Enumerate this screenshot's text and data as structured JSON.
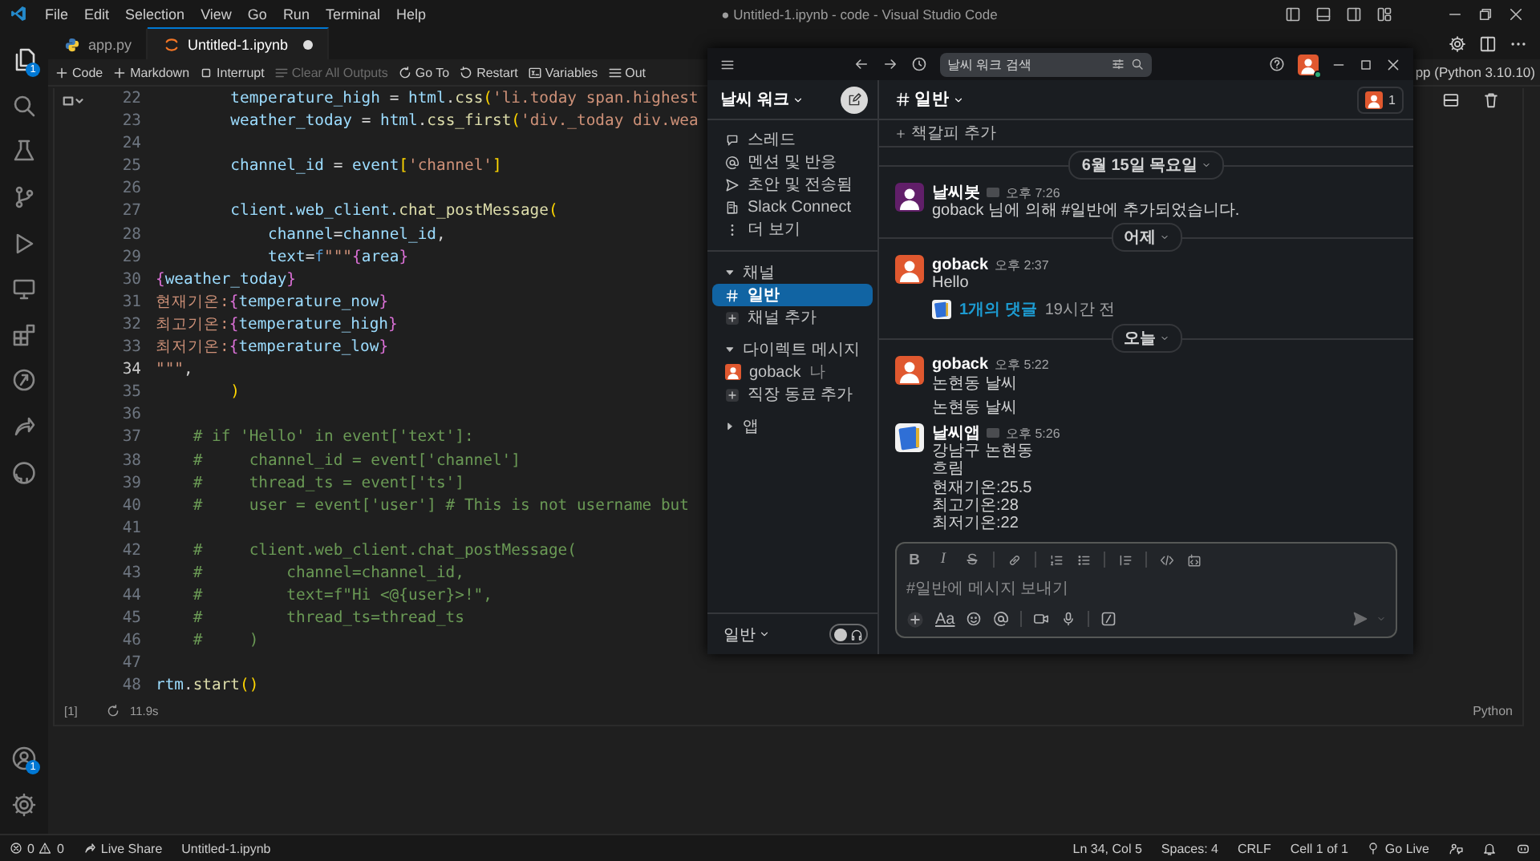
{
  "title_bar": {
    "menus": [
      "File",
      "Edit",
      "Selection",
      "View",
      "Go",
      "Run",
      "Terminal",
      "Help"
    ],
    "title": "● Untitled-1.ipynb - code - Visual Studio Code"
  },
  "activity_bar": {
    "top": [
      {
        "kind": "files",
        "badge": "1"
      },
      {
        "kind": "search"
      },
      {
        "kind": "flask"
      },
      {
        "kind": "branch"
      },
      {
        "kind": "run"
      },
      {
        "kind": "monitor"
      },
      {
        "kind": "blocks"
      },
      {
        "kind": "circle"
      },
      {
        "kind": "share"
      },
      {
        "kind": "octo"
      }
    ],
    "bottom": [
      {
        "kind": "account",
        "badge": "1"
      },
      {
        "kind": "gear"
      }
    ]
  },
  "tabs": [
    {
      "label": "app.py",
      "kind": "python",
      "selected": false,
      "dirty": false
    },
    {
      "label": "Untitled-1.ipynb",
      "kind": "notebook",
      "selected": true,
      "dirty": true
    }
  ],
  "notebook_toolbar": [
    {
      "label": "Code",
      "kind": "plus",
      "disabled": false
    },
    {
      "label": "Markdown",
      "kind": "plus",
      "disabled": false
    },
    {
      "label": "Interrupt",
      "kind": "stop",
      "disabled": false
    },
    {
      "label": "Clear All Outputs",
      "kind": "clear",
      "disabled": true
    },
    {
      "label": "Go To",
      "kind": "goto",
      "disabled": false
    },
    {
      "label": "Restart",
      "kind": "restart",
      "disabled": false
    },
    {
      "label": "Variables",
      "kind": "variables",
      "disabled": false
    },
    {
      "label": "Out",
      "kind": "outline",
      "disabled": false
    }
  ],
  "kernel": "pp (Python 3.10.10)",
  "cell": {
    "execution_count": "[1]",
    "duration": "11.9s",
    "language": "Python",
    "lines": [
      {
        "number": "22",
        "current": false,
        "tokens": [
          {
            "kind": "var",
            "text": "        temperature_high"
          },
          {
            "kind": "op",
            "text": " = "
          },
          {
            "kind": "var",
            "text": "html"
          },
          {
            "kind": "op",
            "text": "."
          },
          {
            "kind": "fn",
            "text": "css"
          },
          {
            "kind": "brace",
            "text": "("
          },
          {
            "kind": "str",
            "text": "'li.today span.highest"
          }
        ]
      },
      {
        "number": "23",
        "current": false,
        "tokens": [
          {
            "kind": "var",
            "text": "        weather_today"
          },
          {
            "kind": "op",
            "text": " = "
          },
          {
            "kind": "var",
            "text": "html"
          },
          {
            "kind": "op",
            "text": "."
          },
          {
            "kind": "fn",
            "text": "css_first"
          },
          {
            "kind": "brace",
            "text": "("
          },
          {
            "kind": "str",
            "text": "'div._today div.wea"
          }
        ]
      },
      {
        "number": "24",
        "current": false
      },
      {
        "number": "25",
        "current": false,
        "tokens": [
          {
            "kind": "var",
            "text": "        channel_id"
          },
          {
            "kind": "op",
            "text": " = "
          },
          {
            "kind": "var",
            "text": "event"
          },
          {
            "kind": "brace",
            "text": "["
          },
          {
            "kind": "str",
            "text": "'channel'"
          },
          {
            "kind": "brace",
            "text": "]"
          }
        ]
      },
      {
        "number": "26",
        "current": false
      },
      {
        "number": "27",
        "current": false,
        "tokens": [
          {
            "kind": "var",
            "text": "        client.web_client."
          },
          {
            "kind": "fn",
            "text": "chat_postMessage"
          },
          {
            "kind": "brace",
            "text": "("
          }
        ]
      },
      {
        "number": "28",
        "current": false,
        "tokens": [
          {
            "kind": "var",
            "text": "            channel"
          },
          {
            "kind": "op",
            "text": "="
          },
          {
            "kind": "var",
            "text": "channel_id"
          },
          {
            "kind": "op",
            "text": ","
          }
        ]
      },
      {
        "number": "29",
        "current": false,
        "tokens": [
          {
            "kind": "var",
            "text": "            text"
          },
          {
            "kind": "op",
            "text": "="
          },
          {
            "kind": "keyword",
            "text": "f"
          },
          {
            "kind": "str",
            "text": "\"\"\""
          },
          {
            "kind": "interp",
            "text": "{"
          },
          {
            "kind": "var",
            "text": "area"
          },
          {
            "kind": "interp",
            "text": "}"
          }
        ]
      },
      {
        "number": "30",
        "current": false,
        "tokens": [
          {
            "kind": "interp",
            "text": "{"
          },
          {
            "kind": "var",
            "text": "weather_today"
          },
          {
            "kind": "interp",
            "text": "}"
          }
        ]
      },
      {
        "number": "31",
        "current": false,
        "tokens": [
          {
            "kind": "str",
            "text": "현재기온:"
          },
          {
            "kind": "interp",
            "text": "{"
          },
          {
            "kind": "var",
            "text": "temperature_now"
          },
          {
            "kind": "interp",
            "text": "}"
          }
        ]
      },
      {
        "number": "32",
        "current": false,
        "tokens": [
          {
            "kind": "str",
            "text": "최고기온:"
          },
          {
            "kind": "interp",
            "text": "{"
          },
          {
            "kind": "var",
            "text": "temperature_high"
          },
          {
            "kind": "interp",
            "text": "}"
          }
        ]
      },
      {
        "number": "33",
        "current": false,
        "tokens": [
          {
            "kind": "str",
            "text": "최저기온:"
          },
          {
            "kind": "interp",
            "text": "{"
          },
          {
            "kind": "var",
            "text": "temperature_low"
          },
          {
            "kind": "interp",
            "text": "}"
          }
        ]
      },
      {
        "number": "34",
        "current": true,
        "tokens": [
          {
            "kind": "str",
            "text": "\"\"\""
          },
          {
            "kind": "op",
            "text": ","
          }
        ]
      },
      {
        "number": "35",
        "current": false,
        "tokens": [
          {
            "kind": "brace",
            "text": "        )"
          }
        ]
      },
      {
        "number": "36",
        "current": false
      },
      {
        "number": "37",
        "current": false,
        "tokens": [
          {
            "kind": "comment",
            "text": "    # if 'Hello' in event['text']:"
          }
        ]
      },
      {
        "number": "38",
        "current": false,
        "tokens": [
          {
            "kind": "comment",
            "text": "    #     channel_id = event['channel']"
          }
        ]
      },
      {
        "number": "39",
        "current": false,
        "tokens": [
          {
            "kind": "comment",
            "text": "    #     thread_ts = event['ts']"
          }
        ]
      },
      {
        "number": "40",
        "current": false,
        "tokens": [
          {
            "kind": "comment",
            "text": "    #     user = event['user'] # This is not username but"
          }
        ]
      },
      {
        "number": "41",
        "current": false
      },
      {
        "number": "42",
        "current": false,
        "tokens": [
          {
            "kind": "comment",
            "text": "    #     client.web_client.chat_postMessage("
          }
        ]
      },
      {
        "number": "43",
        "current": false,
        "tokens": [
          {
            "kind": "comment",
            "text": "    #         channel=channel_id,"
          }
        ]
      },
      {
        "number": "44",
        "current": false,
        "tokens": [
          {
            "kind": "comment",
            "text": "    #         text=f\"Hi <@{user}>!\","
          }
        ]
      },
      {
        "number": "45",
        "current": false,
        "tokens": [
          {
            "kind": "comment",
            "text": "    #         thread_ts=thread_ts"
          }
        ]
      },
      {
        "number": "46",
        "current": false,
        "tokens": [
          {
            "kind": "comment",
            "text": "    #     )"
          }
        ]
      },
      {
        "number": "47",
        "current": false
      },
      {
        "number": "48",
        "current": false,
        "tokens": [
          {
            "kind": "var",
            "text": "rtm"
          },
          {
            "kind": "op",
            "text": "."
          },
          {
            "kind": "fn",
            "text": "start"
          },
          {
            "kind": "brace",
            "text": "()"
          }
        ]
      }
    ]
  },
  "slack": {
    "search": {
      "placeholder": "날씨 워크 검색"
    },
    "workspace": "날씨 워크",
    "nav": [
      {
        "label": "스레드",
        "kind": "threads"
      },
      {
        "label": "멘션 및 반응",
        "kind": "mentions"
      },
      {
        "label": "초안 및 전송됨",
        "kind": "drafts"
      },
      {
        "label": "Slack Connect",
        "kind": "connect"
      },
      {
        "label": "더 보기",
        "kind": "more"
      }
    ],
    "sections": [
      {
        "title": "채널",
        "expanded": true,
        "items": [
          {
            "label": "일반",
            "kind": "channel",
            "selected": true
          },
          {
            "label": "채널 추가",
            "kind": "add",
            "selected": false
          }
        ]
      },
      {
        "title": "다이렉트 메시지",
        "expanded": true,
        "items": [
          {
            "label": "goback",
            "suffix": "나",
            "kind": "user",
            "selected": false
          },
          {
            "label": "직장 동료 추가",
            "kind": "add",
            "selected": false
          }
        ]
      },
      {
        "title": "앱",
        "expanded": false
      }
    ],
    "footer": {
      "label": "일반",
      "huddle_on": false
    },
    "channel": {
      "name": "일반",
      "members": "1",
      "bookmark": "책갈피 추가"
    },
    "feed": [
      {
        "kind": "divider",
        "label": "6월 15일 목요일"
      },
      {
        "kind": "message",
        "avatar": {
          "kind": "bot"
        },
        "author": "날씨봇",
        "app": true,
        "time": "오후 7:26",
        "lines": [
          "goback 님에 의해 #일반에 추가되었습니다."
        ]
      },
      {
        "kind": "divider",
        "label": "어제"
      },
      {
        "kind": "message",
        "avatar": {
          "kind": "user"
        },
        "author": "goback",
        "app": false,
        "time": "오후 2:37",
        "lines": [
          "Hello"
        ],
        "thread": {
          "replies": "1개의 댓글",
          "ago": "19시간 전"
        }
      },
      {
        "kind": "divider",
        "label": "오늘"
      },
      {
        "kind": "message",
        "avatar": {
          "kind": "user"
        },
        "author": "goback",
        "app": false,
        "time": "오후 5:22",
        "lines": [
          "논현동 날씨"
        ]
      },
      {
        "kind": "continuation",
        "lines": [
          "논현동 날씨"
        ]
      },
      {
        "kind": "message",
        "avatar": {
          "kind": "app"
        },
        "author": "날씨앱",
        "app": true,
        "time": "오후 5:26",
        "lines": [
          "강남구 논현동",
          "흐림",
          "현재기온:25.5",
          "최고기온:28",
          "최저기온:22"
        ]
      }
    ],
    "composer": {
      "placeholder": "#일반에 메시지 보내기",
      "format": [
        {
          "kind": "bold",
          "label": "B"
        },
        {
          "kind": "italic",
          "label": "I"
        },
        {
          "kind": "strike",
          "label": "S"
        },
        {
          "kind": "separator"
        },
        {
          "kind": "link"
        },
        {
          "kind": "separator"
        },
        {
          "kind": "ordered"
        },
        {
          "kind": "bullets"
        },
        {
          "kind": "separator"
        },
        {
          "kind": "quote"
        },
        {
          "kind": "separator"
        },
        {
          "kind": "code"
        },
        {
          "kind": "codeblock"
        }
      ],
      "actions": [
        {
          "kind": "plus"
        },
        {
          "kind": "text",
          "label": "Aa"
        },
        {
          "kind": "emoji"
        },
        {
          "kind": "mention"
        },
        {
          "kind": "separator"
        },
        {
          "kind": "video"
        },
        {
          "kind": "mic"
        },
        {
          "kind": "separator"
        },
        {
          "kind": "slash"
        }
      ]
    }
  },
  "status_bar": {
    "left": [
      {
        "kind": "problems",
        "errors": "0",
        "warnings": "0"
      },
      {
        "kind": "liveshare",
        "label": "Live Share"
      },
      {
        "kind": "plain",
        "label": "Untitled-1.ipynb"
      }
    ],
    "right": [
      {
        "kind": "plain",
        "label": "Ln 34, Col 5"
      },
      {
        "kind": "plain",
        "label": "Spaces: 4"
      },
      {
        "kind": "plain",
        "label": "CRLF"
      },
      {
        "kind": "plain",
        "label": "Cell 1 of 1"
      },
      {
        "kind": "golive",
        "label": "Go Live"
      },
      {
        "kind": "feedback"
      },
      {
        "kind": "bell"
      },
      {
        "kind": "copilot"
      }
    ]
  }
}
